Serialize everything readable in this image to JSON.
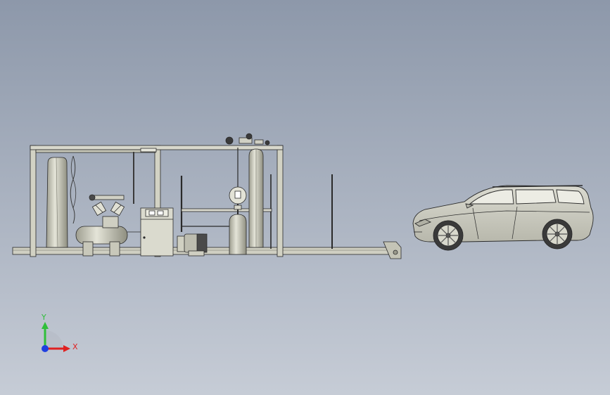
{
  "viewport": {
    "background_top": "#8d98aa",
    "background_bottom": "#c6ccd6",
    "model_fill": "#d6d6c8",
    "model_shade": "#a8a89a",
    "model_edge": "#2a2a2a"
  },
  "triad": {
    "y_label": "Y",
    "x_label": "X",
    "y_color": "#2fbf3a",
    "x_color": "#e02020",
    "z_color": "#1f3fe0"
  }
}
